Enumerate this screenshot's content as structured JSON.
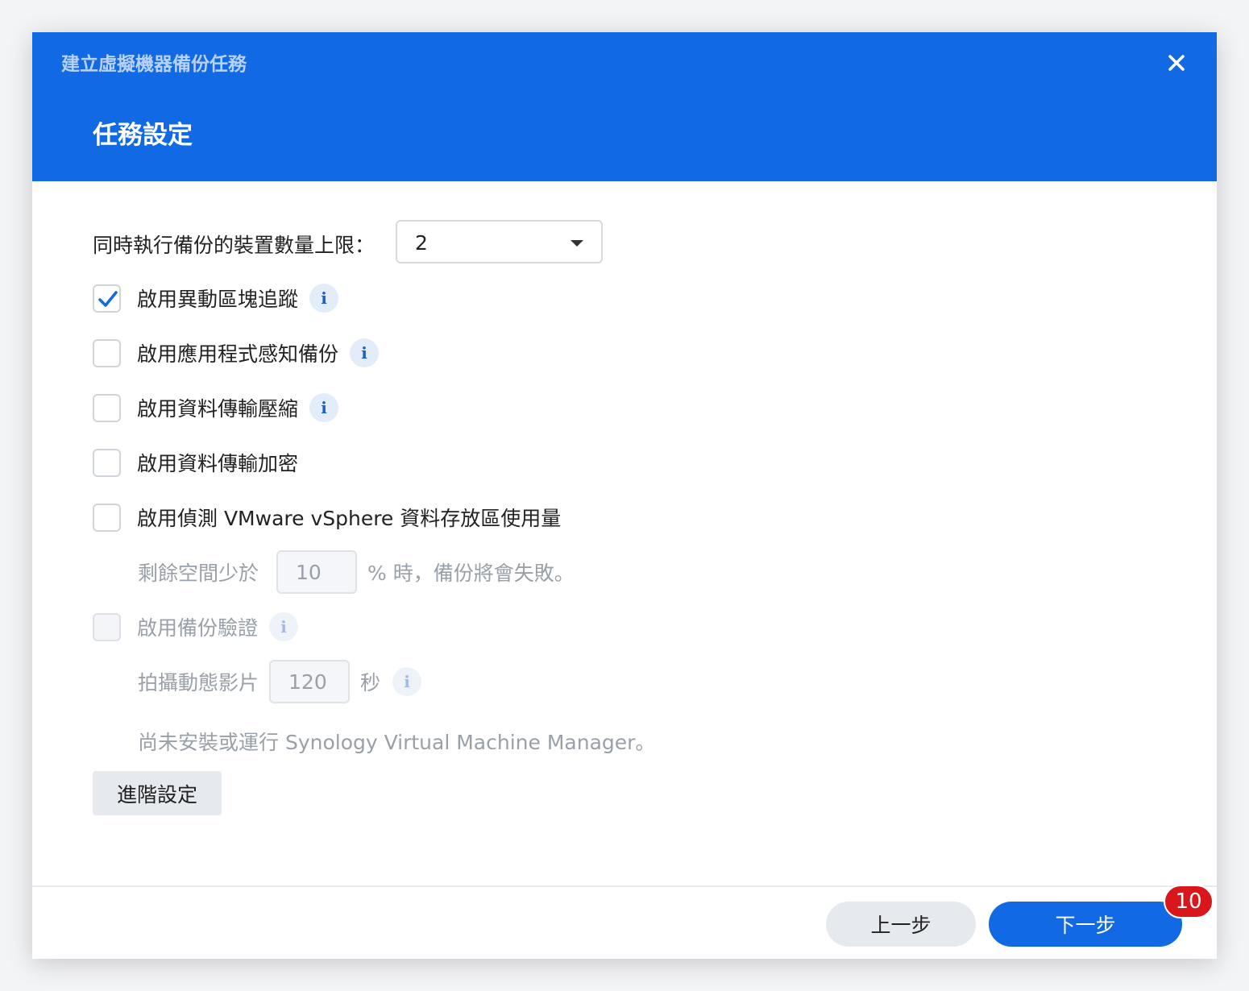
{
  "window": {
    "title": "建立虛擬機器備份任務",
    "step_title": "任務設定"
  },
  "settings": {
    "max_devices_label": "同時執行備份的裝置數量上限：",
    "max_devices_value": "2",
    "options": [
      {
        "label": "啟用異動區塊追蹤",
        "checked": true,
        "has_info": true
      },
      {
        "label": "啟用應用程式感知備份",
        "checked": false,
        "has_info": true
      },
      {
        "label": "啟用資料傳輸壓縮",
        "checked": false,
        "has_info": true
      },
      {
        "label": "啟用資料傳輸加密",
        "checked": false,
        "has_info": false
      },
      {
        "label": "啟用偵測 VMware vSphere 資料存放區使用量",
        "checked": false,
        "has_info": false
      }
    ],
    "space_prefix": "剩餘空間少於",
    "space_value": "10",
    "space_suffix": "% 時，備份將會失敗。",
    "verify_label": "啟用備份驗證",
    "video_prefix": "拍攝動態影片",
    "video_value": "120",
    "video_suffix": "秒",
    "vmm_notice": "尚未安裝或運行 Synology Virtual Machine Manager。",
    "advanced_button": "進階設定"
  },
  "footer": {
    "prev_label": "上一步",
    "next_label": "下一步",
    "badge": "10"
  },
  "colors": {
    "accent": "#1169e4",
    "badge": "#d9161c"
  }
}
